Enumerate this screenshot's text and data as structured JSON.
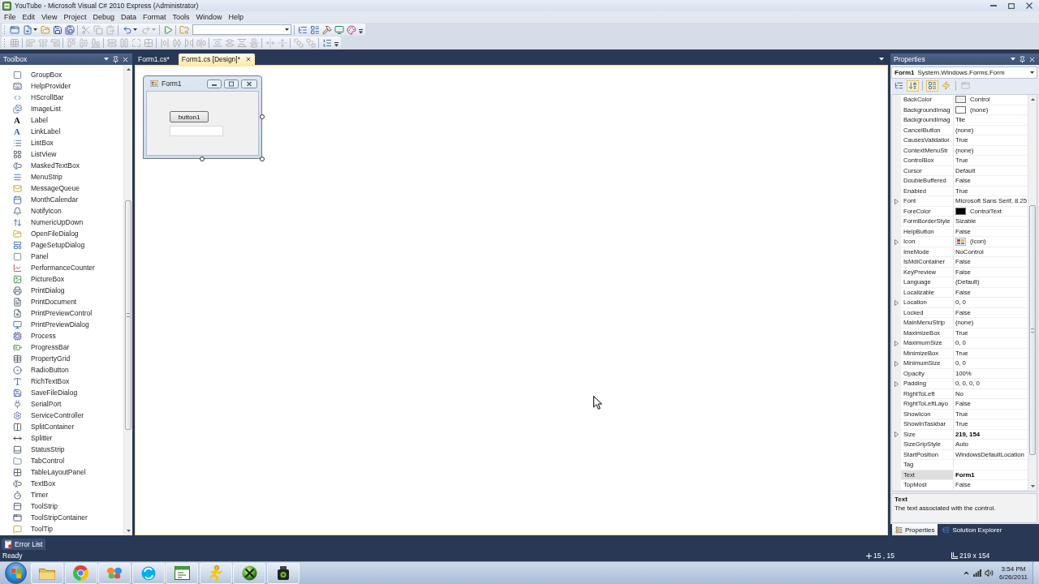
{
  "window": {
    "title": "YouTube - Microsoft Visual C# 2010 Express (Administrator)"
  },
  "menu": [
    "File",
    "Edit",
    "View",
    "Project",
    "Debug",
    "Data",
    "Format",
    "Tools",
    "Window",
    "Help"
  ],
  "toolbars": [
    {
      "groups": [
        [
          {
            "kind": "button",
            "disabled": false
          },
          {
            "kind": "split",
            "disabled": false
          },
          {
            "kind": "button",
            "disabled": false
          },
          {
            "kind": "button",
            "disabled": false
          },
          {
            "kind": "button",
            "disabled": false
          }
        ],
        [
          {
            "kind": "button",
            "disabled": true
          },
          {
            "kind": "button",
            "disabled": true
          },
          {
            "kind": "button",
            "disabled": true
          }
        ],
        [
          {
            "kind": "split",
            "disabled": false
          },
          {
            "kind": "split",
            "disabled": true
          }
        ],
        [
          {
            "kind": "button",
            "disabled": false
          }
        ],
        [
          {
            "kind": "button",
            "disabled": false
          },
          {
            "kind": "combo",
            "disabled": false
          }
        ],
        [
          {
            "kind": "button",
            "disabled": false
          },
          {
            "kind": "button",
            "disabled": false
          },
          {
            "kind": "button",
            "disabled": false
          },
          {
            "kind": "button",
            "disabled": false
          },
          {
            "kind": "button",
            "disabled": false
          },
          {
            "kind": "overflow",
            "disabled": false
          }
        ]
      ]
    },
    {
      "groups": [
        [
          {
            "kind": "button",
            "disabled": true
          }
        ],
        [
          {
            "kind": "button",
            "disabled": true
          },
          {
            "kind": "button",
            "disabled": true
          },
          {
            "kind": "button",
            "disabled": true
          }
        ],
        [
          {
            "kind": "button",
            "disabled": true
          },
          {
            "kind": "button",
            "disabled": true
          },
          {
            "kind": "button",
            "disabled": true
          }
        ],
        [
          {
            "kind": "button",
            "disabled": true
          },
          {
            "kind": "button",
            "disabled": true
          },
          {
            "kind": "button",
            "disabled": true
          },
          {
            "kind": "button",
            "disabled": true
          }
        ],
        [
          {
            "kind": "button",
            "disabled": true
          },
          {
            "kind": "button",
            "disabled": true
          },
          {
            "kind": "button",
            "disabled": true
          },
          {
            "kind": "button",
            "disabled": true
          }
        ],
        [
          {
            "kind": "button",
            "disabled": true
          },
          {
            "kind": "button",
            "disabled": true
          },
          {
            "kind": "button",
            "disabled": true
          },
          {
            "kind": "button",
            "disabled": true
          }
        ],
        [
          {
            "kind": "button",
            "disabled": true
          },
          {
            "kind": "button",
            "disabled": true
          }
        ],
        [
          {
            "kind": "button",
            "disabled": true
          },
          {
            "kind": "button",
            "disabled": true
          }
        ],
        [
          {
            "kind": "button",
            "disabled": false
          },
          {
            "kind": "overflow",
            "disabled": false
          }
        ]
      ]
    }
  ],
  "toolbox": {
    "title": "Toolbox",
    "items": [
      {
        "label": "GroupBox"
      },
      {
        "label": "HelpProvider"
      },
      {
        "label": "HScrollBar"
      },
      {
        "label": "ImageList"
      },
      {
        "label": "Label",
        "glyph": "A"
      },
      {
        "label": "LinkLabel",
        "glyph": "A"
      },
      {
        "label": "ListBox"
      },
      {
        "label": "ListView"
      },
      {
        "label": "MaskedTextBox"
      },
      {
        "label": "MenuStrip"
      },
      {
        "label": "MessageQueue"
      },
      {
        "label": "MonthCalendar"
      },
      {
        "label": "NotifyIcon"
      },
      {
        "label": "NumericUpDown"
      },
      {
        "label": "OpenFileDialog"
      },
      {
        "label": "PageSetupDialog"
      },
      {
        "label": "Panel"
      },
      {
        "label": "PerformanceCounter"
      },
      {
        "label": "PictureBox"
      },
      {
        "label": "PrintDialog"
      },
      {
        "label": "PrintDocument"
      },
      {
        "label": "PrintPreviewControl"
      },
      {
        "label": "PrintPreviewDialog"
      },
      {
        "label": "Process"
      },
      {
        "label": "ProgressBar"
      },
      {
        "label": "PropertyGrid"
      },
      {
        "label": "RadioButton"
      },
      {
        "label": "RichTextBox"
      },
      {
        "label": "SaveFileDialog"
      },
      {
        "label": "SerialPort"
      },
      {
        "label": "ServiceController"
      },
      {
        "label": "SplitContainer"
      },
      {
        "label": "Splitter"
      },
      {
        "label": "StatusStrip"
      },
      {
        "label": "TabControl"
      },
      {
        "label": "TableLayoutPanel"
      },
      {
        "label": "TextBox"
      },
      {
        "label": "Timer"
      },
      {
        "label": "ToolStrip"
      },
      {
        "label": "ToolStripContainer"
      },
      {
        "label": "ToolTip"
      }
    ]
  },
  "documents": {
    "tabs": [
      {
        "label": "Form1.cs*",
        "selected": false
      },
      {
        "label": "Form1.cs [Design]*",
        "selected": true
      }
    ]
  },
  "designer": {
    "form": {
      "title": "Form1",
      "controls": [
        {
          "kind": "button",
          "label": "button1"
        },
        {
          "kind": "textbox"
        }
      ]
    }
  },
  "properties": {
    "title": "Properties",
    "object": {
      "name": "Form1",
      "type": "System.Windows.Forms.Form"
    },
    "toolbar": [
      [
        {
          "selected": false,
          "disabled": false
        },
        {
          "selected": true,
          "disabled": false
        }
      ],
      [
        {
          "selected": true,
          "disabled": false
        },
        {
          "selected": false,
          "disabled": false
        }
      ],
      [
        {
          "selected": false,
          "disabled": true
        }
      ]
    ],
    "rows": [
      {
        "name": "BackColor",
        "value": "Control",
        "kind": "color",
        "color": "#f0f0f0",
        "expandable": false,
        "modified": false,
        "selected": false
      },
      {
        "name": "BackgroundImag",
        "value": "(none)",
        "kind": "blank",
        "expandable": false,
        "modified": false,
        "selected": false
      },
      {
        "name": "BackgroundImag",
        "value": "Tile",
        "kind": "text",
        "expandable": false,
        "modified": false,
        "selected": false
      },
      {
        "name": "CancelButton",
        "value": "(none)",
        "kind": "text",
        "expandable": false,
        "modified": false,
        "selected": false
      },
      {
        "name": "CausesValidatior",
        "value": "True",
        "kind": "text",
        "expandable": false,
        "modified": false,
        "selected": false
      },
      {
        "name": "ContextMenuStr",
        "value": "(none)",
        "kind": "text",
        "expandable": false,
        "modified": false,
        "selected": false
      },
      {
        "name": "ControlBox",
        "value": "True",
        "kind": "text",
        "expandable": false,
        "modified": false,
        "selected": false
      },
      {
        "name": "Cursor",
        "value": "Default",
        "kind": "text",
        "expandable": false,
        "modified": false,
        "selected": false
      },
      {
        "name": "DoubleBuffered",
        "value": "False",
        "kind": "text",
        "expandable": false,
        "modified": false,
        "selected": false
      },
      {
        "name": "Enabled",
        "value": "True",
        "kind": "text",
        "expandable": false,
        "modified": false,
        "selected": false
      },
      {
        "name": "Font",
        "value": "Microsoft Sans Serif, 8.25",
        "kind": "text",
        "expandable": true,
        "modified": false,
        "selected": false
      },
      {
        "name": "ForeColor",
        "value": "ControlText",
        "kind": "color",
        "color": "#000000",
        "expandable": false,
        "modified": false,
        "selected": false
      },
      {
        "name": "FormBorderStyle",
        "value": "Sizable",
        "kind": "text",
        "expandable": false,
        "modified": false,
        "selected": false
      },
      {
        "name": "HelpButton",
        "value": "False",
        "kind": "text",
        "expandable": false,
        "modified": false,
        "selected": false
      },
      {
        "name": "Icon",
        "value": "(Icon)",
        "kind": "image",
        "expandable": true,
        "modified": false,
        "selected": false
      },
      {
        "name": "ImeMode",
        "value": "NoControl",
        "kind": "text",
        "expandable": false,
        "modified": false,
        "selected": false
      },
      {
        "name": "IsMdiContainer",
        "value": "False",
        "kind": "text",
        "expandable": false,
        "modified": false,
        "selected": false
      },
      {
        "name": "KeyPreview",
        "value": "False",
        "kind": "text",
        "expandable": false,
        "modified": false,
        "selected": false
      },
      {
        "name": "Language",
        "value": "(Default)",
        "kind": "text",
        "expandable": false,
        "modified": false,
        "selected": false
      },
      {
        "name": "Localizable",
        "value": "False",
        "kind": "text",
        "expandable": false,
        "modified": false,
        "selected": false
      },
      {
        "name": "Location",
        "value": "0, 0",
        "kind": "text",
        "expandable": true,
        "modified": false,
        "selected": false
      },
      {
        "name": "Locked",
        "value": "False",
        "kind": "text",
        "expandable": false,
        "modified": false,
        "selected": false
      },
      {
        "name": "MainMenuStrip",
        "value": "(none)",
        "kind": "text",
        "expandable": false,
        "modified": false,
        "selected": false
      },
      {
        "name": "MaximizeBox",
        "value": "True",
        "kind": "text",
        "expandable": false,
        "modified": false,
        "selected": false
      },
      {
        "name": "MaximumSize",
        "value": "0, 0",
        "kind": "text",
        "expandable": true,
        "modified": false,
        "selected": false
      },
      {
        "name": "MinimizeBox",
        "value": "True",
        "kind": "text",
        "expandable": false,
        "modified": false,
        "selected": false
      },
      {
        "name": "MinimumSize",
        "value": "0, 0",
        "kind": "text",
        "expandable": true,
        "modified": false,
        "selected": false
      },
      {
        "name": "Opacity",
        "value": "100%",
        "kind": "text",
        "expandable": false,
        "modified": false,
        "selected": false
      },
      {
        "name": "Padding",
        "value": "0, 0, 0, 0",
        "kind": "text",
        "expandable": true,
        "modified": false,
        "selected": false
      },
      {
        "name": "RightToLeft",
        "value": "No",
        "kind": "text",
        "expandable": false,
        "modified": false,
        "selected": false
      },
      {
        "name": "RightToLeftLayo",
        "value": "False",
        "kind": "text",
        "expandable": false,
        "modified": false,
        "selected": false
      },
      {
        "name": "ShowIcon",
        "value": "True",
        "kind": "text",
        "expandable": false,
        "modified": false,
        "selected": false
      },
      {
        "name": "ShowInTaskbar",
        "value": "True",
        "kind": "text",
        "expandable": false,
        "modified": false,
        "selected": false
      },
      {
        "name": "Size",
        "value": "219, 154",
        "kind": "text",
        "expandable": true,
        "modified": true,
        "selected": false
      },
      {
        "name": "SizeGripStyle",
        "value": "Auto",
        "kind": "text",
        "expandable": false,
        "modified": false,
        "selected": false
      },
      {
        "name": "StartPosition",
        "value": "WindowsDefaultLocation",
        "kind": "text",
        "expandable": false,
        "modified": false,
        "selected": false
      },
      {
        "name": "Tag",
        "kind": "text",
        "expandable": false,
        "selected": false
      },
      {
        "name": "Text",
        "value": "Form1",
        "kind": "text",
        "expandable": false,
        "modified": true,
        "selected": true
      },
      {
        "name": "TopMost",
        "value": "False",
        "kind": "text",
        "expandable": false,
        "modified": false,
        "selected": false
      }
    ],
    "description": {
      "title": "Text",
      "text": "The text associated with the control."
    },
    "tabs": [
      {
        "label": "Properties",
        "selected": true
      },
      {
        "label": "Solution Explorer",
        "selected": false
      }
    ]
  },
  "error_list": {
    "label": "Error List"
  },
  "status_bar": {
    "text": "Ready",
    "position": "15 , 15",
    "size": "219 x 154"
  },
  "taskbar": {
    "clock": {
      "time": "3:54 PM",
      "date": "6/26/2011"
    }
  }
}
